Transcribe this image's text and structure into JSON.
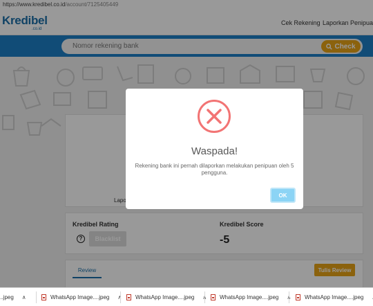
{
  "browser": {
    "url_host": "https://www.kredibel.co.id",
    "url_path": "/account/7125405449"
  },
  "header": {
    "logo_text": "Kredibel",
    "logo_sub": ".co.id",
    "nav": [
      "Cek Rekening",
      "Laporkan Penipuan"
    ]
  },
  "search": {
    "placeholder": "Nomor rekening bank",
    "button_label": "Check"
  },
  "page": {
    "report_label_fragment": "Lapo",
    "rating_label": "Kredibel Rating",
    "rating_help": "?",
    "rating_badge": "Blacklist",
    "score_label": "Kredibel Score",
    "score_value": "-5",
    "tab_review": "Review",
    "write_review_button": "Tulis Review"
  },
  "modal": {
    "title": "Waspada!",
    "message": "Rekening bank ini pernah dilaporkan melakukan penipuan oleh 5 pengguna.",
    "ok_label": "OK",
    "icon": "error-x-icon",
    "icon_color": "#f27474"
  },
  "downloads": [
    {
      "name": "...jpeg"
    },
    {
      "name": "WhatsApp Image....jpeg"
    },
    {
      "name": "WhatsApp Image....jpeg"
    },
    {
      "name": "WhatsApp Image....jpeg"
    },
    {
      "name": "WhatsApp Image....jpeg"
    }
  ],
  "colors": {
    "brand_blue": "#1d7fc6",
    "accent_orange": "#e8a417"
  }
}
